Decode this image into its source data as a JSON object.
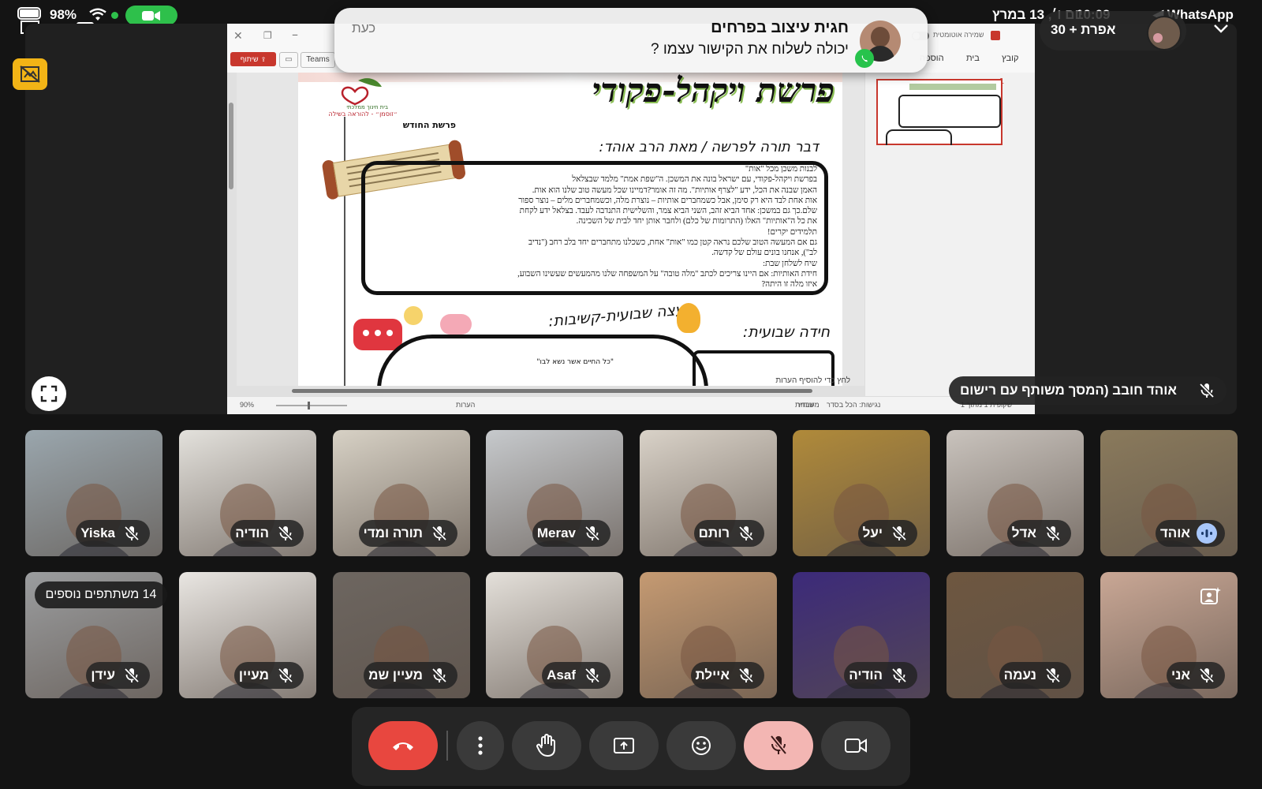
{
  "status_bar": {
    "battery_percent": "98%",
    "time": "10:09",
    "date": "יום ו׳, 13 במרץ",
    "app_back_label": "◀ WhatsApp",
    "call_active_color": "#2ec04b"
  },
  "notification": {
    "app": "WhatsApp",
    "sender": "חגית עיצוב בפרחים",
    "message": "יכולה לשלוח את הקישור עצמו ?",
    "time": "כעת"
  },
  "participants_header": {
    "count_label": "אפרת + 30"
  },
  "presenter": {
    "label": "אוהד חובב (המסך משותף עם רישום"
  },
  "word_app": {
    "ribbon_tabs": [
      "קובץ",
      "בית",
      "הוספה"
    ],
    "teams_label": "Teams",
    "share_label": "שיתוף",
    "toggle_label": "שמירה אוטומטית",
    "page_number": "1",
    "zoom": "90%",
    "notes_placeholder": "לחץ כדי להוסיף הערות",
    "status_notes": "הערות",
    "status_items": [
      "שקופית 1 מתוך 1",
      "עברית",
      "נגישות: הכל בסדר",
      "משוחזר"
    ]
  },
  "document": {
    "title": "פרשת ויקהל-פקודי",
    "logo_caption": "בית חינוך ממלכתי",
    "logo_tagline": "״זוסמן״ - להוראה בשילה",
    "month_label": "פרשת החודש",
    "torah_heading": "דבר תורה לפרשה / מאת הרב אוהד:",
    "torah_lines": [
      "לבנות משכן מכל \"אות\"",
      "בפרשת ויקהל-פקודי, עם ישראל בונה את המשכן. ה\"שפת אמת\" מלמד שבצלאל",
      "האמן שבנה את הכל, ידע \"לצרף אותיות\". מה זה אומר?דמיינו שכל מעשה טוב שלנו הוא אות.",
      "אות אחת לבד היא רק סימן, אבל כשמחברים אותיות – נוצרת מלה, וכשמחברים מלים – נוצר ספור",
      "שלם.כך גם במשכן: אחד הביא זהב, השני הביא צמר, והשלישית התנדבה לעבד. בצלאל ידע לקחת",
      "את כל ה\"אותיות\" האלו (התרומות של כלם) ולחבר אותן יחד לבית של השכינה.",
      "תלמידים יקרים!",
      "גם אם המעשה הטוב שלכם נראה קטן כמו \"אות\" אחת, כשכלנו מתחברים יחד בלב רחב (\"נדיב",
      "לב\"), אנחנו בונים עולם של קדשה.",
      "שיח לשלחן שבת:",
      "חידת האותיות: אם היינו צריכים לכתב \"מלה טובה\" על המשפחה שלנו מהמעשים שעשינו השבוע,",
      "איזו מלה זו היתה?"
    ],
    "riddle_heading": "חידה שבועית:",
    "tip_heading": "עצה שבועית-קשיבות:",
    "tip_quote": "\"כל החיים אשר נשא לבו\""
  },
  "tiles": [
    {
      "name": "אוהד",
      "mic": "speaking",
      "bg": "#8a7a5c"
    },
    {
      "name": "אדל",
      "mic": "muted",
      "bg": "#c9c3bd"
    },
    {
      "name": "יעל",
      "mic": "muted",
      "bg": "#b08a3a"
    },
    {
      "name": "רותם",
      "mic": "muted",
      "bg": "#d9d2c8"
    },
    {
      "name": "Merav",
      "mic": "muted",
      "bg": "#c6c9cc"
    },
    {
      "name": "תורה ומדי",
      "mic": "muted",
      "bg": "#d7d1c5"
    },
    {
      "name": "הודיה",
      "mic": "muted",
      "bg": "#e3e1dc"
    },
    {
      "name": "Yiska",
      "mic": "muted",
      "bg": "#9aa6ad"
    },
    {
      "name": "אני",
      "mic": "muted",
      "bg": "#c9a795"
    },
    {
      "name": "נעמה",
      "mic": "muted",
      "bg": "#6e5740"
    },
    {
      "name": "הודיה",
      "mic": "muted",
      "bg": "#3c2a7a"
    },
    {
      "name": "איילת",
      "mic": "muted",
      "bg": "#c59a72"
    },
    {
      "name": "Asaf",
      "mic": "muted",
      "bg": "#e4e0da"
    },
    {
      "name": "מעיין שמ",
      "mic": "muted",
      "bg": "#6d6660"
    },
    {
      "name": "מעיין",
      "mic": "muted",
      "bg": "#e9e6e2"
    },
    {
      "name": "עידן",
      "mic": "muted",
      "bg": "#9b9d9f"
    }
  ],
  "more_participants": "14 משתתפים נוספים",
  "controls": {
    "end_call_color": "#e8473f",
    "mic_muted_bg": "#f3b6b3"
  }
}
